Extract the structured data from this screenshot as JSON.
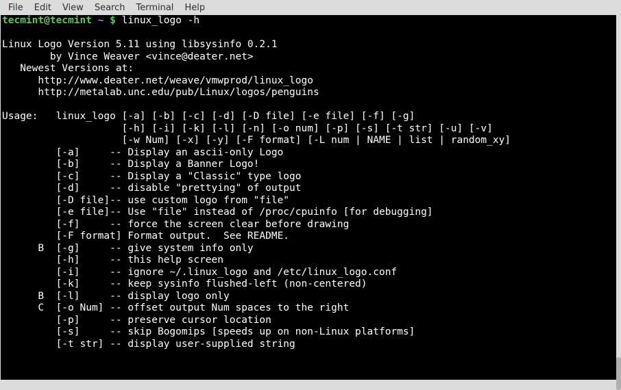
{
  "menubar": {
    "items": [
      "File",
      "Edit",
      "View",
      "Search",
      "Terminal",
      "Help"
    ]
  },
  "prompt": {
    "user_host": "tecmint@tecmint",
    "cwd": "~",
    "symbol": "$",
    "command": "linux_logo -h"
  },
  "output": {
    "version_line": "Linux Logo Version 5.11 using libsysinfo 0.2.1",
    "author_line": "        by Vince Weaver <vince@deater.net>",
    "newest_heading": "   Newest Versions at:",
    "url1": "      http://www.deater.net/weave/vmwprod/linux_logo",
    "url2": "      http://metalab.unc.edu/pub/Linux/logos/penguins",
    "usage_l1": "Usage:   linux_logo [-a] [-b] [-c] [-d] [-D file] [-e file] [-f] [-g]",
    "usage_l2": "                    [-h] [-i] [-k] [-l] [-n] [-o num] [-p] [-s] [-t str] [-u] [-v]",
    "usage_l3": "                    [-w Num] [-x] [-y] [-F format] [-L num | NAME | list | random_xy]",
    "opt_a": "         [-a]     -- Display an ascii-only Logo",
    "opt_b": "         [-b]     -- Display a Banner Logo!",
    "opt_c": "         [-c]     -- Display a \"Classic\" type logo",
    "opt_d": "         [-d]     -- disable \"prettying\" of output",
    "opt_D": "         [-D file]-- use custom logo from \"file\"",
    "opt_e": "         [-e file]-- Use \"file\" instead of /proc/cpuinfo [for debugging]",
    "opt_f": "         [-f]     -- force the screen clear before drawing",
    "opt_F": "         [-F format] Format output.  See README.",
    "opt_g": "      B  [-g]     -- give system info only",
    "opt_h": "         [-h]     -- this help screen",
    "opt_i": "         [-i]     -- ignore ~/.linux_logo and /etc/linux_logo.conf",
    "opt_k": "         [-k]     -- keep sysinfo flushed-left (non-centered)",
    "opt_l": "      B  [-l]     -- display logo only",
    "opt_o": "      C  [-o Num] -- offset output Num spaces to the right",
    "opt_p": "         [-p]     -- preserve cursor location",
    "opt_s": "         [-s]     -- skip Bogomips [speeds up on non-Linux platforms]",
    "opt_t": "         [-t str] -- display user-supplied string"
  }
}
